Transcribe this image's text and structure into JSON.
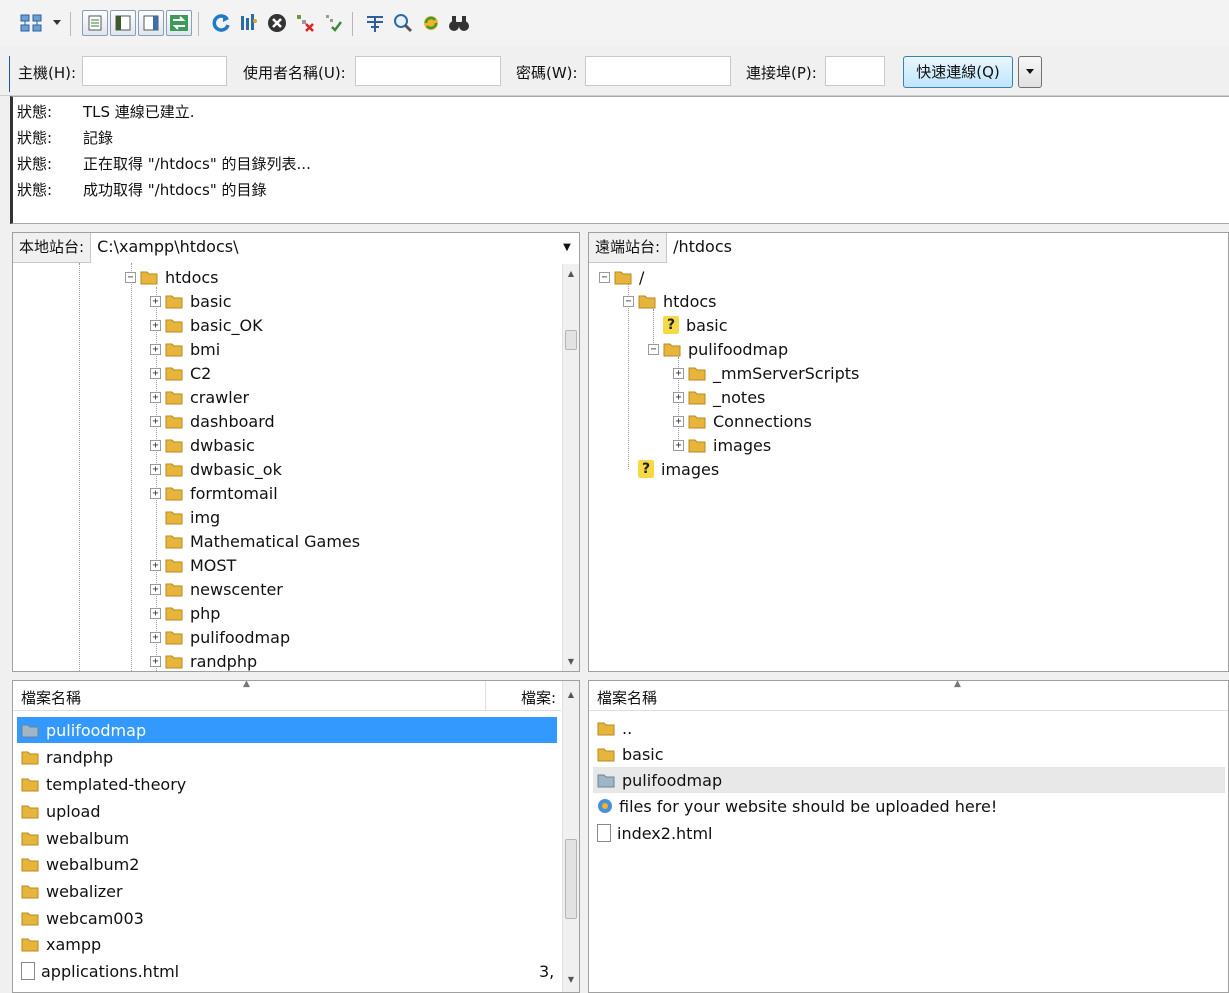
{
  "quickconnect": {
    "host_label": "主機(H):",
    "host_value": "",
    "user_label": "使用者名稱(U):",
    "user_value": "",
    "pass_label": "密碼(W):",
    "pass_value": "",
    "port_label": "連接埠(P):",
    "port_value": "",
    "connect_button": "快速連線(Q)"
  },
  "log": {
    "lines": [
      {
        "key": "狀態:",
        "text": "TLS 連線已建立."
      },
      {
        "key": "狀態:",
        "text": "記錄"
      },
      {
        "key": "狀態:",
        "text": "正在取得 \"/htdocs\" 的目錄列表..."
      },
      {
        "key": "狀態:",
        "text": "成功取得 \"/htdocs\" 的目錄"
      }
    ]
  },
  "local": {
    "site_label": "本地站台:",
    "path": "C:\\xampp\\htdocs\\",
    "tree": [
      "htdocs",
      "basic",
      "basic_OK",
      "bmi",
      "C2",
      "crawler",
      "dashboard",
      "dwbasic",
      "dwbasic_ok",
      "formtomail",
      "img",
      "Mathematical Games",
      "MOST",
      "newscenter",
      "php",
      "pulifoodmap",
      "randphp"
    ],
    "list_header_name": "檔案名稱",
    "list_header_size": "檔案:",
    "files": [
      "pulifoodmap",
      "randphp",
      "templated-theory",
      "upload",
      "webalbum",
      "webalbum2",
      "webalizer",
      "webcam003",
      "xampp",
      "applications.html"
    ],
    "last_file_size": "3,"
  },
  "remote": {
    "site_label": "遠端站台:",
    "path": "/htdocs",
    "tree": [
      "/",
      "htdocs",
      "basic",
      "pulifoodmap",
      "_mmServerScripts",
      "_notes",
      "Connections",
      "images",
      "images"
    ],
    "list_header_name": "檔案名稱",
    "files": [
      "..",
      "basic",
      "pulifoodmap",
      "files for your website should be uploaded here!",
      "index2.html"
    ]
  },
  "colors": {
    "selection": "#3399ff",
    "folder": "#e8b53c",
    "connect_button_bg": "#bee6fd"
  }
}
